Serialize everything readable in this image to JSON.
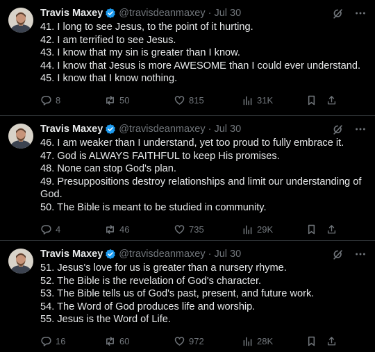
{
  "tweets": [
    {
      "author_name": "Travis Maxey",
      "handle": "@travisdeanmaxey",
      "separator": "·",
      "date": "Jul 30",
      "lines": [
        "41. I long to see Jesus, to the point of it hurting.",
        "42. I am terrified to see Jesus.",
        "43. I know that my sin is greater than I know.",
        "44. I know that Jesus is more AWESOME than I could ever understand.",
        "45. I know that I know nothing."
      ],
      "replies": "8",
      "reposts": "50",
      "likes": "815",
      "views": "31K"
    },
    {
      "author_name": "Travis Maxey",
      "handle": "@travisdeanmaxey",
      "separator": "·",
      "date": "Jul 30",
      "lines": [
        "46. I am weaker than I understand, yet too proud to fully embrace it.",
        "47. God is ALWAYS FAITHFUL to keep His promises.",
        "48. None can stop God's plan.",
        "49. Presuppositions destroy relationships and limit our understanding of",
        "God.",
        "50. The Bible is meant to be studied in community."
      ],
      "replies": "4",
      "reposts": "46",
      "likes": "735",
      "views": "29K"
    },
    {
      "author_name": "Travis Maxey",
      "handle": "@travisdeanmaxey",
      "separator": "·",
      "date": "Jul 30",
      "lines": [
        "51. Jesus's love for us is greater than a nursery rhyme.",
        "52. The Bible is the revelation of God's character.",
        "53. The Bible tells us of God's past, present, and future work.",
        "54. The Word of God produces life and worship.",
        "55. Jesus is the Word of Life."
      ],
      "replies": "16",
      "reposts": "60",
      "likes": "972",
      "views": "28K"
    }
  ],
  "colors": {
    "background": "#000000",
    "text": "#e7e9ea",
    "muted": "#71767b",
    "verified": "#1d9bf0",
    "divider": "#2f3336"
  },
  "icons": {
    "verified": "verified-badge-icon",
    "grok": "grok-icon",
    "more": "more-options-icon",
    "reply": "reply-icon",
    "repost": "repost-icon",
    "like": "heart-icon",
    "views": "views-icon",
    "bookmark": "bookmark-icon",
    "share": "share-icon"
  }
}
